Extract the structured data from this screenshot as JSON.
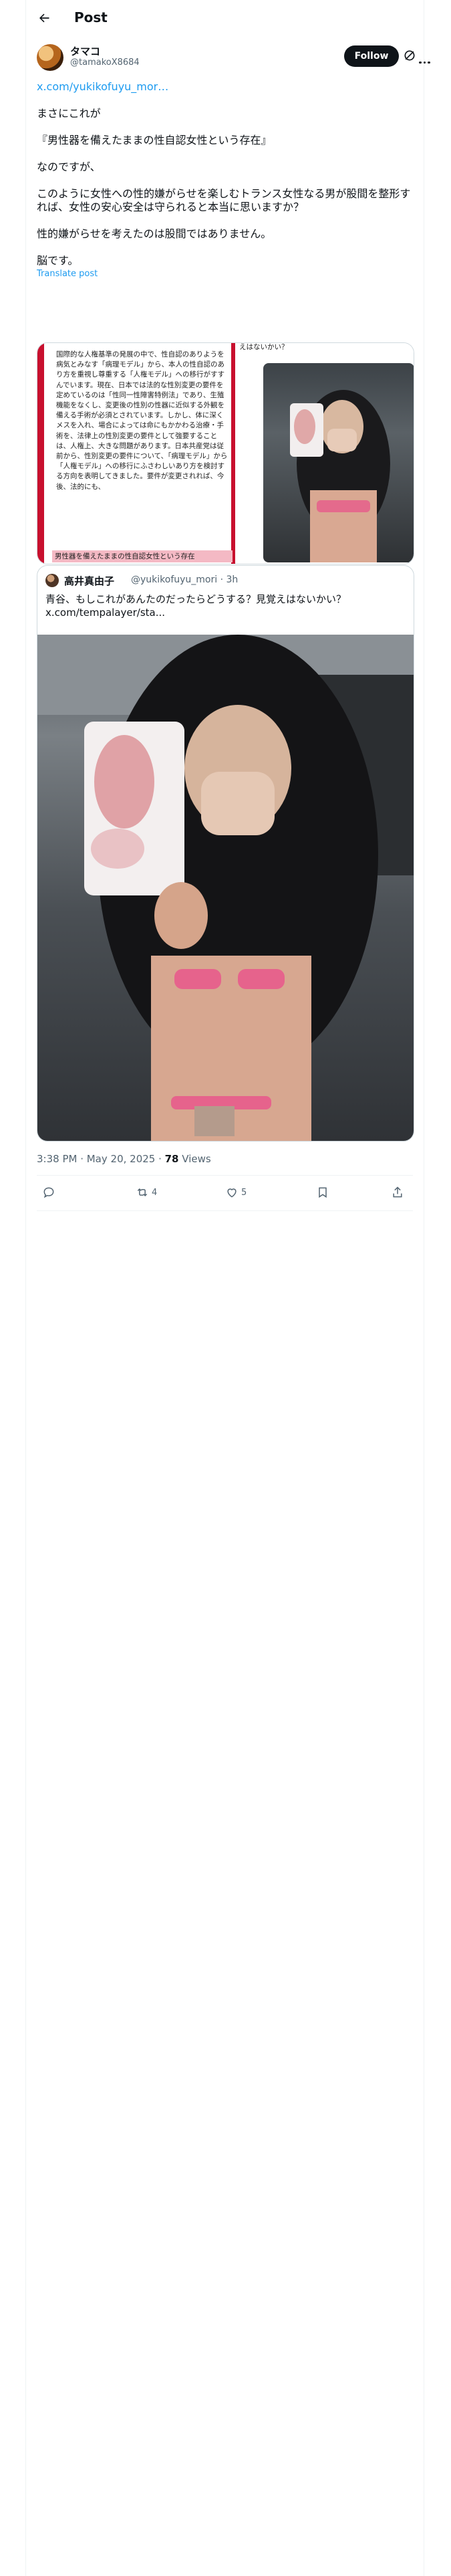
{
  "header": {
    "title": "Post"
  },
  "author": {
    "name": "タマコ",
    "handle": "@tamakoX8684",
    "follow_label": "Follow"
  },
  "post": {
    "link": "x.com/yukikofuyu_mor…",
    "lines": [
      "まさにこれが",
      "『男性器を備えたままの性自認女性という存在』",
      "なのですが、",
      "このように女性への性的嫌がらせを楽しむトランス女性なる男が股間を整形すれば、女性の安心安全は守られると本当に思いますか？",
      "性的嫌がらせを考えたのは股間ではありません。",
      "脳です。"
    ],
    "translate": "Translate post"
  },
  "media_doc": {
    "text": "国際的な人権基準の発展の中で、性自認のありようを病気とみなす「病理モデル」から、本人の性自認のあり方を重視し尊重する「人権モデル」への移行がすすんでいます。現在、日本では法的な性別変更の要件を定めているのは「性同一性障害特例法」であり、生殖機能をなくし、変更後の性別の性器に近似する外観を備える手術が必須とされています。しかし、体に深くメスを入れ、場合によっては命にもかかわる治療・手術を、法律上の性別変更の要件として強要することは、人権上、大きな問題があります。日本共産党は従前から、性別変更の要件について、「病理モデル」から「人権モデル」への移行にふさわしいあり方を検討する方向を表明してきました。要件が変更されれば、今後、法的にも、",
    "highlight": "男性器を備えたままの性自認女性という存在",
    "caption": "えはないかい？"
  },
  "quote": {
    "name": "高井真由子",
    "handle": "@yukikofuyu_mori · 3h",
    "text": "青谷、もしこれがあんたのだったらどうする？見覚えはないかい？",
    "link": "x.com/tempalayer/sta..."
  },
  "meta": {
    "time": "3:38 PM · May 20, 2025 · ",
    "views_count": "78",
    "views_label": " Views"
  },
  "actions": {
    "reply_count": "",
    "repost_count": "4",
    "like_count": "5"
  },
  "colors": {
    "accent": "#1d9bf0",
    "text": "#0f1419",
    "muted": "#536471",
    "border": "#cfd9de",
    "doc_red": "#c8102e"
  }
}
